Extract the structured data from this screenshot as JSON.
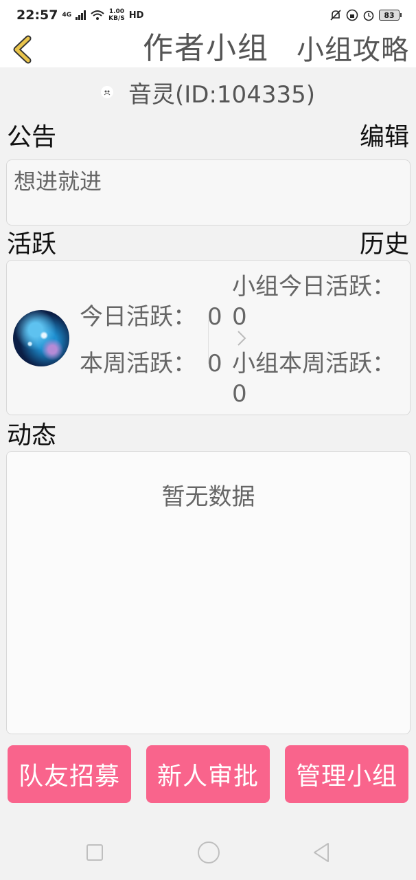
{
  "status_bar": {
    "time": "22:57",
    "network": "4G",
    "speed_value": "1.00",
    "speed_unit": "KB/S",
    "hd": "HD",
    "battery": "83"
  },
  "header": {
    "title": "作者小组",
    "action": "小组攻略"
  },
  "group": {
    "name": "音灵(ID:104335)"
  },
  "notice": {
    "title": "公告",
    "edit_label": "编辑",
    "text": "想进就进"
  },
  "activity": {
    "title": "活跃",
    "history_label": "历史",
    "today_label": "今日活跃：",
    "today_value": "0",
    "week_label": "本周活跃：",
    "week_value": "0",
    "group_today_label": "小组今日活跃：",
    "group_today_value": "0",
    "group_week_label": "小组本周活跃：",
    "group_week_value": "0"
  },
  "feed": {
    "title": "动态",
    "empty_text": "暂无数据"
  },
  "buttons": {
    "recruit": "队友招募",
    "approve": "新人审批",
    "manage": "管理小组"
  },
  "colors": {
    "accent": "#f9648c",
    "back_arrow": "#e9c44b"
  }
}
